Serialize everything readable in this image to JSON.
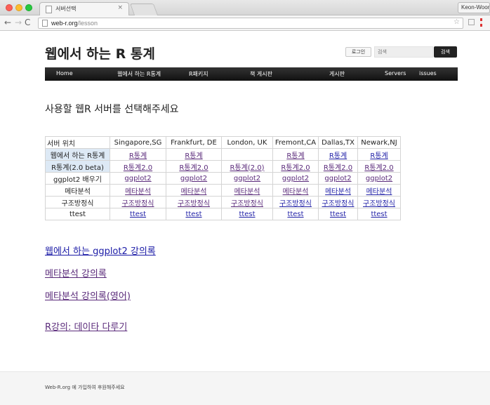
{
  "browser": {
    "tab_title": "서버선택",
    "tab_close": "×",
    "profile_name": "Keon-Woong",
    "url_host": "web-r.org",
    "url_path": "/lesson",
    "nav_back": "←",
    "nav_forward": "→",
    "nav_reload": "C",
    "bookmark_star": "☆"
  },
  "header": {
    "site_title": "웹에서 하는 R 통계",
    "login_label": "로그인",
    "search_placeholder": "검색",
    "search_button": "검색"
  },
  "navbar": {
    "items": [
      "Home",
      "웹에서 하는 R통계",
      "R패키지",
      "책 게시판",
      "게시판",
      "Servers",
      "issues"
    ]
  },
  "main": {
    "heading": "사용할 웹R 서버를 선택해주세요"
  },
  "server_table": {
    "header": [
      "서버 위치",
      "Singapore,SG",
      "Frankfurt, DE",
      "London, UK",
      "Fremont,CA",
      "Dallas,TX",
      "Newark,NJ"
    ],
    "rows": [
      {
        "label": "웹에서 하는 R통계",
        "cells": [
          "R통계",
          "R통계",
          "",
          "R통계",
          "R통계",
          "R통계"
        ]
      },
      {
        "label": "R통계(2.0 beta)",
        "cells": [
          "R통계2.0",
          "R통계2.0",
          "R통계(2.0)",
          "R통계2.0",
          "R통계2.0",
          "R통계2.0"
        ]
      },
      {
        "label": "ggplot2 배우기",
        "cells": [
          "ggplot2",
          "ggplot2",
          "ggplot2",
          "ggplot2",
          "ggplot2",
          "ggplot2"
        ]
      },
      {
        "label": "메타분석",
        "cells": [
          "메타분석",
          "메타분석",
          "메타분석",
          "메타분석",
          "메타분석",
          "메타분석"
        ]
      },
      {
        "label": "구조방정식",
        "cells": [
          "구조방정식",
          "구조방정식",
          "구조방정식",
          "구조방정식",
          "구조방정식",
          "구조방정식"
        ]
      },
      {
        "label": "ttest",
        "cells": [
          "ttest",
          "ttest",
          "ttest",
          "ttest",
          "ttest",
          "ttest"
        ]
      }
    ]
  },
  "lecture_links": [
    "웹에서 하는 ggplot2 강의록",
    "메타분석 강의록",
    "메타분석 강의록(영어)",
    "R강의: 데이타 다루기"
  ],
  "footer": {
    "text": "Web-R.org 에 가입하여 후원해주세요"
  },
  "colors": {
    "navbar_bg": "#1a1a1a",
    "link": "#1a1aa6",
    "visited_link": "#5a2a7a",
    "highlight": "#dde9f5"
  }
}
